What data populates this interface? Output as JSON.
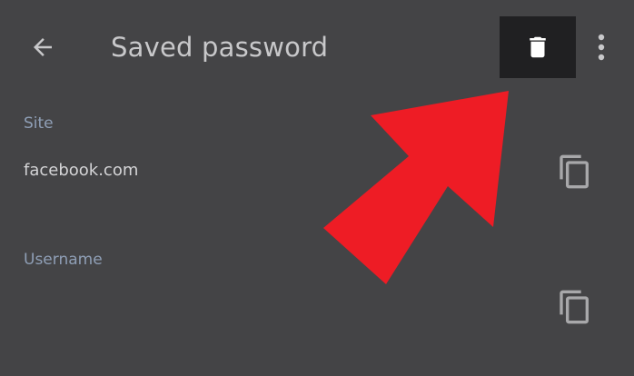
{
  "header": {
    "title": "Saved password",
    "back_icon": "arrow-back-icon",
    "delete_icon": "trash-icon",
    "more_icon": "more-vert-icon"
  },
  "fields": {
    "site": {
      "label": "Site",
      "value": "facebook.com",
      "copy_icon": "copy-icon"
    },
    "username": {
      "label": "Username",
      "value": "",
      "copy_icon": "copy-icon"
    }
  },
  "colors": {
    "background": "#444446",
    "delete_highlight": "#202022",
    "label_accent": "#8f9fb6",
    "annotation_arrow": "#ee1c25"
  }
}
